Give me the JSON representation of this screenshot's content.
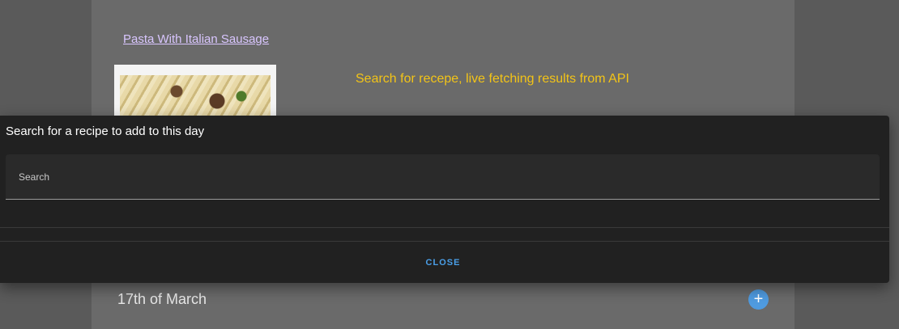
{
  "background": {
    "recipe_link": "Pasta With Italian Sausage",
    "api_note": "Search for recepe, live fetching results from API",
    "day_label": "17th of March",
    "add_button_glyph": "+"
  },
  "dialog": {
    "title": "Search for a recipe to add to this day",
    "search": {
      "label": "Search",
      "value": ""
    },
    "close_label": "CLOSE"
  },
  "colors": {
    "accent": "#4a9fe8",
    "note": "#f3c417",
    "link": "#d9c6ff",
    "dialog_bg": "#212121"
  },
  "icons": {
    "add": "plus-icon",
    "thumbnail": "pasta-image"
  }
}
